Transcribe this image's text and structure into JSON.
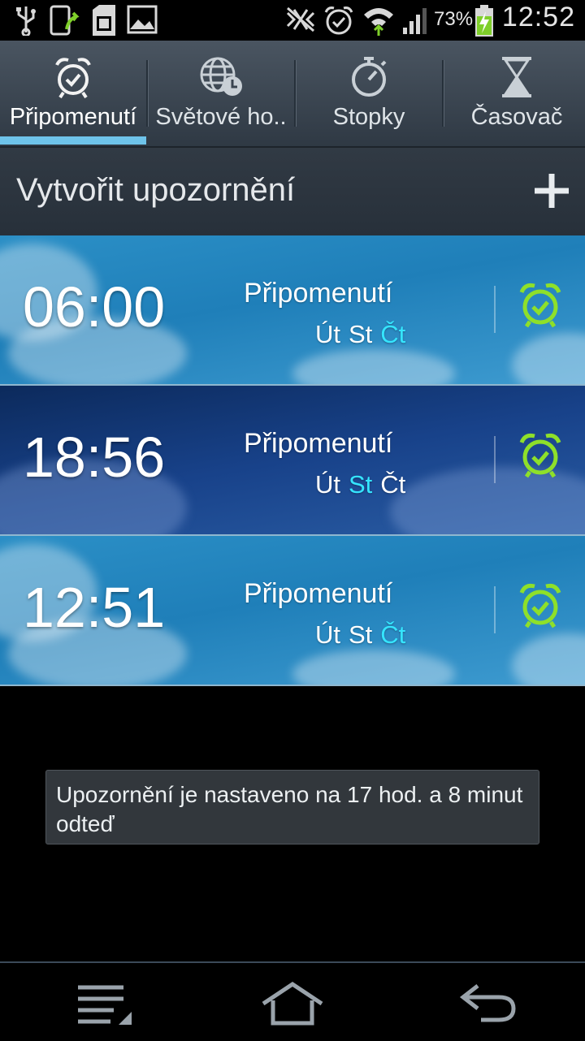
{
  "status_bar": {
    "battery_percent": "73%",
    "time": "12:52",
    "icons": [
      "usb-icon",
      "phone-upload-icon",
      "sd-card-icon",
      "image-icon",
      "mute-icon",
      "alarm-icon",
      "wifi-icon",
      "signal-icon",
      "battery-charging-icon"
    ]
  },
  "tabs": [
    {
      "label": "Připomenutí",
      "icon": "alarm-clock-icon",
      "active": true
    },
    {
      "label": "Světové ho..",
      "icon": "world-clock-icon",
      "active": false
    },
    {
      "label": "Stopky",
      "icon": "stopwatch-icon",
      "active": false
    },
    {
      "label": "Časovač",
      "icon": "hourglass-icon",
      "active": false
    }
  ],
  "create": {
    "label": "Vytvořit upozornění",
    "icon": "plus-icon"
  },
  "alarms": [
    {
      "time": "06:00",
      "name": "Připomenutí",
      "days": [
        "Út",
        "St",
        "Čt"
      ],
      "highlighted_day": "Čt",
      "theme": "day",
      "enabled": true
    },
    {
      "time": "18:56",
      "name": "Připomenutí",
      "days": [
        "Út",
        "St",
        "Čt"
      ],
      "highlighted_day": "St",
      "theme": "night",
      "enabled": true
    },
    {
      "time": "12:51",
      "name": "Připomenutí",
      "days": [
        "Út",
        "St",
        "Čt"
      ],
      "highlighted_day": "Čt",
      "theme": "day",
      "enabled": true
    }
  ],
  "toast": {
    "text": "Upozornění je nastaveno na 17 hod. a 8 minut odteď"
  },
  "colors": {
    "accent": "#6ec3ea",
    "highlight_day": "#35e5ff",
    "alarm_icon_green": "#8ee02a"
  },
  "navbar": {
    "icons": [
      "menu-icon",
      "home-icon",
      "back-icon"
    ]
  }
}
